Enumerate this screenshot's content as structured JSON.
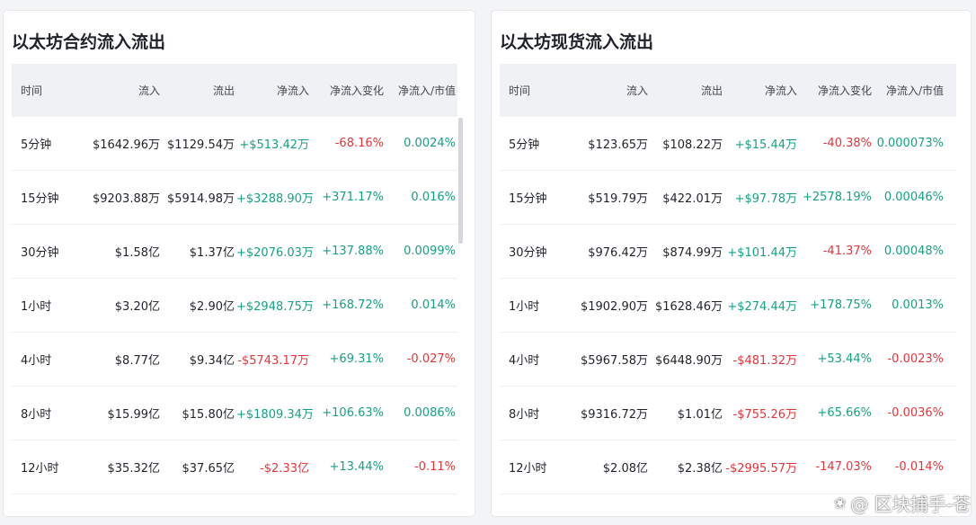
{
  "contract": {
    "title": "以太坊合约流入流出",
    "headers": [
      "时间",
      "流入",
      "流出",
      "净流入",
      "净流入变化",
      "净流入/市值"
    ],
    "rows": [
      {
        "time": "5分钟",
        "inflow": "$1642.96万",
        "outflow": "$1129.54万",
        "net": "+$513.42万",
        "change": "-68.16%",
        "ratio": "0.0024%"
      },
      {
        "time": "15分钟",
        "inflow": "$9203.88万",
        "outflow": "$5914.98万",
        "net": "+$3288.90万",
        "change": "+371.17%",
        "ratio": "0.016%"
      },
      {
        "time": "30分钟",
        "inflow": "$1.58亿",
        "outflow": "$1.37亿",
        "net": "+$2076.03万",
        "change": "+137.88%",
        "ratio": "0.0099%"
      },
      {
        "time": "1小时",
        "inflow": "$3.20亿",
        "outflow": "$2.90亿",
        "net": "+$2948.75万",
        "change": "+168.72%",
        "ratio": "0.014%"
      },
      {
        "time": "4小时",
        "inflow": "$8.77亿",
        "outflow": "$9.34亿",
        "net": "-$5743.17万",
        "change": "+69.31%",
        "ratio": "-0.027%"
      },
      {
        "time": "8小时",
        "inflow": "$15.99亿",
        "outflow": "$15.80亿",
        "net": "+$1809.34万",
        "change": "+106.63%",
        "ratio": "0.0086%"
      },
      {
        "time": "12小时",
        "inflow": "$35.32亿",
        "outflow": "$37.65亿",
        "net": "-$2.33亿",
        "change": "+13.44%",
        "ratio": "-0.11%"
      }
    ]
  },
  "spot": {
    "title": "以太坊现货流入流出",
    "headers": [
      "时间",
      "流入",
      "流出",
      "净流入",
      "净流入变化",
      "净流入/市值"
    ],
    "rows": [
      {
        "time": "5分钟",
        "inflow": "$123.65万",
        "outflow": "$108.22万",
        "net": "+$15.44万",
        "change": "-40.38%",
        "ratio": "0.000073%"
      },
      {
        "time": "15分钟",
        "inflow": "$519.79万",
        "outflow": "$422.01万",
        "net": "+$97.78万",
        "change": "+2578.19%",
        "ratio": "0.00046%"
      },
      {
        "time": "30分钟",
        "inflow": "$976.42万",
        "outflow": "$874.99万",
        "net": "+$101.44万",
        "change": "-41.37%",
        "ratio": "0.00048%"
      },
      {
        "time": "1小时",
        "inflow": "$1902.90万",
        "outflow": "$1628.46万",
        "net": "+$274.44万",
        "change": "+178.75%",
        "ratio": "0.0013%"
      },
      {
        "time": "4小时",
        "inflow": "$5967.58万",
        "outflow": "$6448.90万",
        "net": "-$481.32万",
        "change": "+53.44%",
        "ratio": "-0.0023%"
      },
      {
        "time": "8小时",
        "inflow": "$9316.72万",
        "outflow": "$1.01亿",
        "net": "-$755.26万",
        "change": "+65.66%",
        "ratio": "-0.0036%"
      },
      {
        "time": "12小时",
        "inflow": "$2.08亿",
        "outflow": "$2.38亿",
        "net": "-$2995.57万",
        "change": "-147.03%",
        "ratio": "-0.014%"
      }
    ]
  },
  "watermark": {
    "text": "@ 区块捕手-苍",
    "icon": "wechat-channel-icon"
  },
  "colors": {
    "positive": "#16a085",
    "negative": "#e5343a"
  }
}
